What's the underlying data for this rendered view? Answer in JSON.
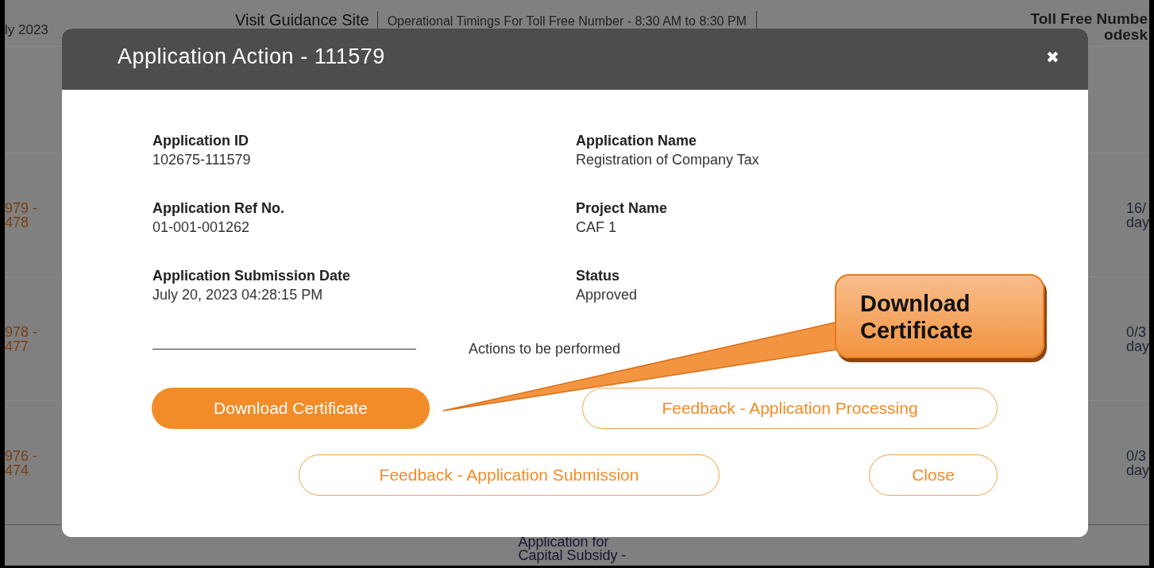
{
  "page": {
    "header": {
      "date_fragment": "ly 2023",
      "guidance_link": "Visit Guidance Site",
      "timings": "Operational Timings For Toll Free Number - 8:30 AM to 8:30 PM",
      "toll_free": "Toll Free Numbe",
      "helpdesk": "odesk"
    },
    "rows": [
      {
        "id_lines": [
          "979 -",
          "478"
        ],
        "days_lines": [
          "16/",
          "day"
        ]
      },
      {
        "id_lines": [
          "978 -",
          "477"
        ],
        "days_lines": [
          "0/3",
          "day"
        ]
      },
      {
        "id_lines": [
          "976 -",
          "474"
        ],
        "days_lines": [
          "0/3",
          "day"
        ]
      }
    ],
    "last_row": {
      "service_lines": [
        "Application for",
        "Capital Subsidy -"
      ]
    }
  },
  "modal": {
    "title": "Application Action - 111579",
    "close": "✖",
    "fields": [
      {
        "label": "Application ID",
        "value": "102675-111579"
      },
      {
        "label": "Application Name",
        "value": "Registration of Company Tax"
      },
      {
        "label": "Application Ref No.",
        "value": "01-001-001262"
      },
      {
        "label": "Project Name",
        "value": "CAF 1"
      },
      {
        "label": "Application Submission Date",
        "value": "July 20, 2023 04:28:15 PM"
      },
      {
        "label": "Status",
        "value": "Approved"
      }
    ],
    "actions_label": "Actions to be performed",
    "buttons": [
      {
        "label": "Download Certificate",
        "kind": "primary"
      },
      {
        "label": "Feedback - Application Processing",
        "kind": "outline"
      },
      {
        "label": "Feedback - Application Submission",
        "kind": "outline"
      },
      {
        "label": "Close",
        "kind": "outline"
      }
    ]
  },
  "callout": {
    "text": "Download Certificate"
  }
}
